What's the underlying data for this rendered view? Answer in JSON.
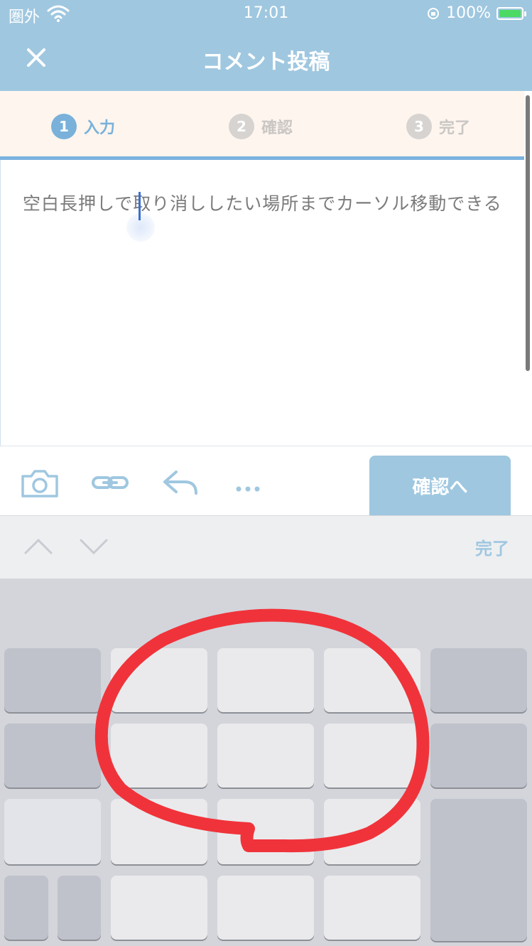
{
  "status_bar": {
    "carrier": "圏外",
    "time": "17:01",
    "battery": "100%"
  },
  "header": {
    "title": "コメント投稿",
    "close_icon": "close-icon"
  },
  "steps": [
    {
      "number": "1",
      "label": "入力",
      "active": true
    },
    {
      "number": "2",
      "label": "確認",
      "active": false
    },
    {
      "number": "3",
      "label": "完了",
      "active": false
    }
  ],
  "comment": {
    "text": "空白長押しで取り消ししたい場所までカーソル移動できる"
  },
  "toolbar": {
    "icons": [
      "camera-icon",
      "link-icon",
      "reply-icon",
      "more-icon"
    ],
    "confirm_label": "確認へ"
  },
  "keyboard_accessory": {
    "done_label": "完了"
  },
  "colors": {
    "header": "#9fc7e0",
    "accent": "#79b1da",
    "annotation": "#f0333a"
  }
}
